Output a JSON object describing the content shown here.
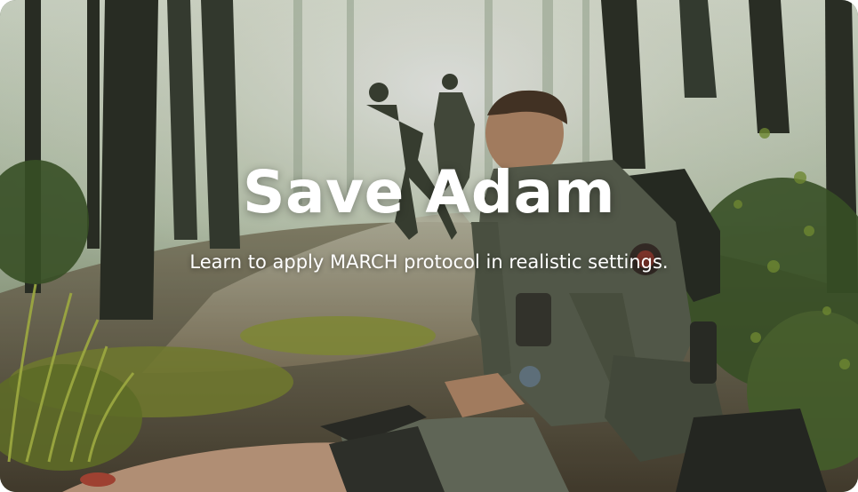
{
  "hero": {
    "title": "Save Adam",
    "subtitle": "Learn to apply MARCH protocol in realistic settings."
  },
  "scene": {
    "icon": "forest-scene-illustration"
  },
  "colors": {
    "title_text": "#ffffff",
    "subtitle_text": "#ffffff"
  }
}
